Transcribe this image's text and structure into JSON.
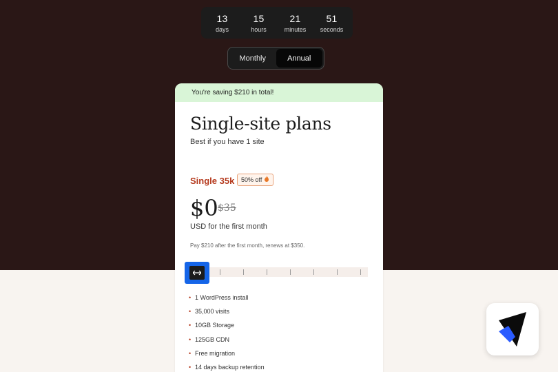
{
  "countdown": [
    {
      "value": "13",
      "label": "days"
    },
    {
      "value": "15",
      "label": "hours"
    },
    {
      "value": "21",
      "label": "minutes"
    },
    {
      "value": "51",
      "label": "seconds"
    }
  ],
  "billing_toggle": {
    "options": [
      "Monthly",
      "Annual"
    ],
    "selected": "Annual"
  },
  "plan_card": {
    "savings_banner": "You're saving $210 in total!",
    "title": "Single-site plans",
    "subtitle": "Best if you have 1 site",
    "plan_name": "Single 35k",
    "discount_badge": "50% off",
    "price": "$0",
    "original_price": "$35",
    "price_note": "USD for the first month",
    "renewal_note": "Pay $210 after the first month, renews at $350.",
    "features": [
      "1 WordPress install",
      "35,000 visits",
      "10GB Storage",
      "125GB CDN",
      "Free migration",
      "14 days backup retention"
    ]
  },
  "icons": {
    "slider_handle": "horizontal-arrows-icon",
    "badge": "fire-icon",
    "app": "app-logo-icon"
  },
  "colors": {
    "top_background": "#2a1716",
    "savings_banner": "#d9f5d7",
    "plan_name": "#b53a1e",
    "highlight": "#1565e8"
  }
}
